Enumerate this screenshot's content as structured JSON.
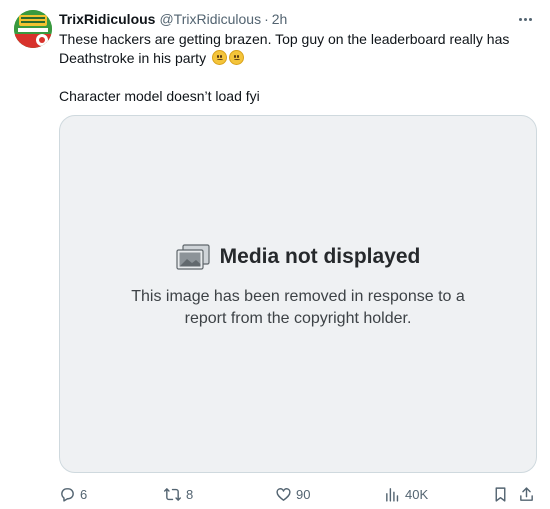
{
  "tweet": {
    "display_name": "TrixRidiculous",
    "handle": "@TrixRidiculous",
    "separator": "·",
    "time": "2h",
    "text_line1": "These hackers are getting brazen.  Top guy on the leaderboard really has",
    "text_line2": "Deathstroke in his party",
    "text_line3": "Character model doesn’t load fyi",
    "emoji": [
      "worried-face-emoji",
      "worried-face-emoji"
    ]
  },
  "media": {
    "title": "Media not displayed",
    "desc_line1": "This image has been removed in response to a",
    "desc_line2": "report from the copyright holder."
  },
  "actions": {
    "replies": "6",
    "retweets": "8",
    "likes": "90",
    "views": "40K"
  },
  "icons": {
    "more": "more-dots-icon",
    "reply": "reply-icon",
    "retweet": "retweet-icon",
    "like": "heart-icon",
    "views": "views-icon",
    "bookmark": "bookmark-icon",
    "share": "share-icon",
    "media": "image-placeholder-icon"
  },
  "colors": {
    "text": "#0f1419",
    "secondary": "#536471",
    "media_bg": "#eff1f3",
    "media_border": "#cfd9de",
    "avatar_green": "#2f8f3a",
    "avatar_red": "#d8322b"
  }
}
